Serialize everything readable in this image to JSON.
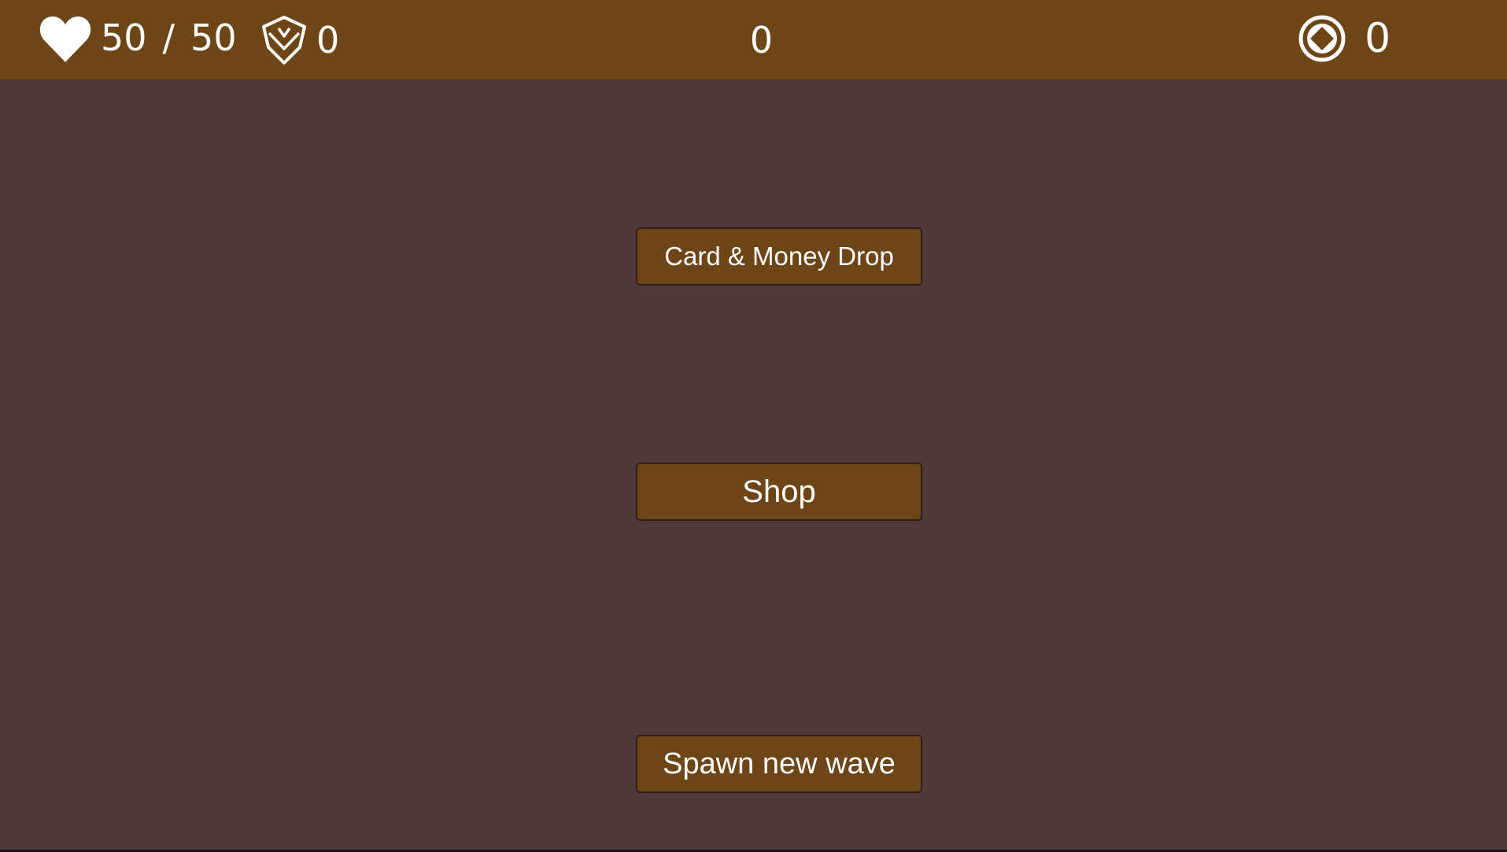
{
  "hud": {
    "health_current": "50",
    "health_separator": "/",
    "health_max": "50",
    "shield_value": "0",
    "center_counter": "0",
    "coin_value": "0",
    "icons": {
      "health": "heart-icon",
      "shield": "shield-icon",
      "coin": "coin-icon"
    }
  },
  "buttons": {
    "card_money_drop": "Card & Money Drop",
    "shop": "Shop",
    "spawn_wave": "Spawn new wave"
  },
  "colors": {
    "hud_bar": "#6d4516",
    "background": "#4e383a",
    "button": "#6d4516",
    "text": "#ffffff"
  }
}
